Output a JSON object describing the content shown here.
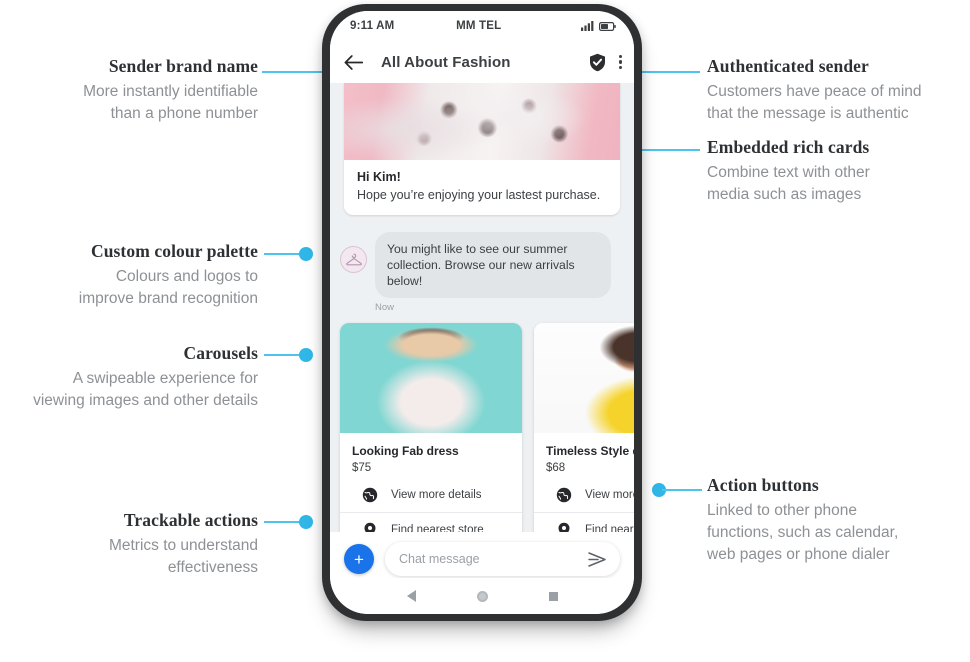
{
  "annotations": {
    "left": [
      {
        "id": "sender-brand-name",
        "title": "Sender brand name",
        "body": [
          "More instantly identifiable",
          "than a phone number"
        ]
      },
      {
        "id": "custom-colour-palette",
        "title": "Custom colour palette",
        "body": [
          "Colours and logos to",
          "improve brand recognition"
        ]
      },
      {
        "id": "carousels",
        "title": "Carousels",
        "body": [
          "A swipeable experience for",
          "viewing images and other details"
        ]
      },
      {
        "id": "trackable-actions",
        "title": "Trackable actions",
        "body": [
          "Metrics to understand",
          "effectiveness"
        ]
      }
    ],
    "right": [
      {
        "id": "authenticated-sender",
        "title": "Authenticated sender",
        "body": [
          "Customers have peace of mind",
          "that the message is authentic"
        ]
      },
      {
        "id": "embedded-rich-cards",
        "title": "Embedded rich cards",
        "body": [
          "Combine text with other",
          "media such as images"
        ]
      },
      {
        "id": "action-buttons",
        "title": "Action buttons",
        "body": [
          "Linked to other phone",
          "functions, such as calendar,",
          "web pages or phone dialer"
        ]
      }
    ]
  },
  "colors": {
    "connector": "#4ec3ee",
    "dot": "#30b7e8",
    "fab": "#1a73e8",
    "title": "#2e3134",
    "body": "#8d9195"
  },
  "phone": {
    "status_bar": {
      "time": "9:11 AM",
      "carrier": "MM TEL",
      "signal_icon": "signal-bars-icon",
      "battery_icon": "battery-icon"
    },
    "app_bar": {
      "back_icon": "back-arrow-icon",
      "title": "All About Fashion",
      "verified_icon": "shield-check-icon",
      "menu_icon": "kebab-menu-icon"
    },
    "rich_card": {
      "image_alt": "floral-dress-photo",
      "heading": "Hi Kim!",
      "text": "Hope you’re enjoying your lastest purchase."
    },
    "message": {
      "avatar_icon": "clothes-hanger-avatar-icon",
      "text": "You might like to see our summer collection. Browse our new arrivals below!",
      "timestamp": "Now"
    },
    "carousel": [
      {
        "image_alt": "woman-sunglasses-floral-top",
        "title": "Looking Fab dress",
        "price": "$75",
        "actions": [
          {
            "icon": "globe-icon",
            "label": "View more details"
          },
          {
            "icon": "location-pin-icon",
            "label": "Find nearest store"
          }
        ]
      },
      {
        "image_alt": "woman-yellow-jacket",
        "title": "Timeless Style dress",
        "price": "$68",
        "actions": [
          {
            "icon": "globe-icon",
            "label": "View more details"
          },
          {
            "icon": "location-pin-icon",
            "label": "Find nearest store"
          }
        ]
      }
    ],
    "composer": {
      "add_label": "+",
      "placeholder": "Chat message",
      "input_value": "",
      "send_icon": "send-icon"
    },
    "nav_bar": {
      "back_icon": "nav-back-icon",
      "home_icon": "nav-home-icon",
      "recents_icon": "nav-recents-icon"
    }
  }
}
